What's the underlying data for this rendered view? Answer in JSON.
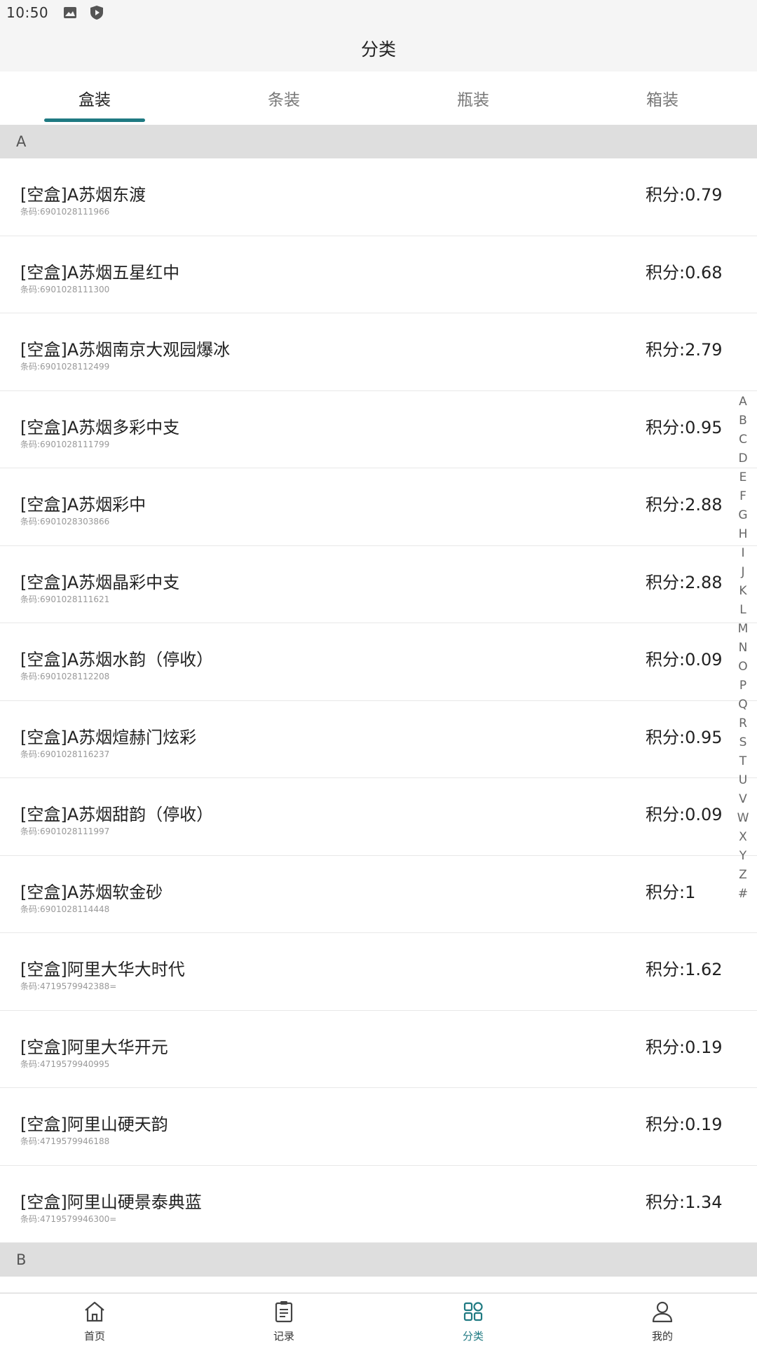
{
  "status_bar": {
    "time": "10:50"
  },
  "header": {
    "title": "分类"
  },
  "tabs": [
    {
      "label": "盒装",
      "active": true
    },
    {
      "label": "条装",
      "active": false
    },
    {
      "label": "瓶装",
      "active": false
    },
    {
      "label": "箱装",
      "active": false
    }
  ],
  "sections": [
    {
      "letter": "A",
      "items": [
        {
          "name": "[空盒]A苏烟东渡",
          "code": "条码:6901028111966",
          "score": "积分:0.79"
        },
        {
          "name": "[空盒]A苏烟五星红中",
          "code": "条码:6901028111300",
          "score": "积分:0.68"
        },
        {
          "name": "[空盒]A苏烟南京大观园爆冰",
          "code": "条码:6901028112499",
          "score": "积分:2.79"
        },
        {
          "name": "[空盒]A苏烟多彩中支",
          "code": "条码:6901028111799",
          "score": "积分:0.95"
        },
        {
          "name": "[空盒]A苏烟彩中",
          "code": "条码:6901028303866",
          "score": "积分:2.88"
        },
        {
          "name": "[空盒]A苏烟晶彩中支",
          "code": "条码:6901028111621",
          "score": "积分:2.88"
        },
        {
          "name": "[空盒]A苏烟水韵（停收）",
          "code": "条码:6901028112208",
          "score": "积分:0.09"
        },
        {
          "name": "[空盒]A苏烟煊赫门炫彩",
          "code": "条码:6901028116237",
          "score": "积分:0.95"
        },
        {
          "name": "[空盒]A苏烟甜韵（停收）",
          "code": "条码:6901028111997",
          "score": "积分:0.09"
        },
        {
          "name": "[空盒]A苏烟软金砂",
          "code": "条码:6901028114448",
          "score": "积分:1"
        },
        {
          "name": "[空盒]阿里大华大时代",
          "code": "条码:4719579942388=",
          "score": "积分:1.62"
        },
        {
          "name": "[空盒]阿里大华开元",
          "code": "条码:4719579940995",
          "score": "积分:0.19"
        },
        {
          "name": "[空盒]阿里山硬天韵",
          "code": "条码:4719579946188",
          "score": "积分:0.19"
        },
        {
          "name": "[空盒]阿里山硬景泰典蓝",
          "code": "条码:4719579946300=",
          "score": "积分:1.34"
        }
      ]
    },
    {
      "letter": "B",
      "items": []
    }
  ],
  "alpha_index": [
    "A",
    "B",
    "C",
    "D",
    "E",
    "F",
    "G",
    "H",
    "I",
    "J",
    "K",
    "L",
    "M",
    "N",
    "O",
    "P",
    "Q",
    "R",
    "S",
    "T",
    "U",
    "V",
    "W",
    "X",
    "Y",
    "Z",
    "#"
  ],
  "bottom_nav": [
    {
      "label": "首页",
      "icon": "home-icon",
      "active": false
    },
    {
      "label": "记录",
      "icon": "clipboard-icon",
      "active": false
    },
    {
      "label": "分类",
      "icon": "grid-icon",
      "active": true
    },
    {
      "label": "我的",
      "icon": "user-icon",
      "active": false
    }
  ],
  "colors": {
    "accent": "#1f7a82",
    "section_bg": "#dedede",
    "bar_bg": "#f5f5f5"
  }
}
